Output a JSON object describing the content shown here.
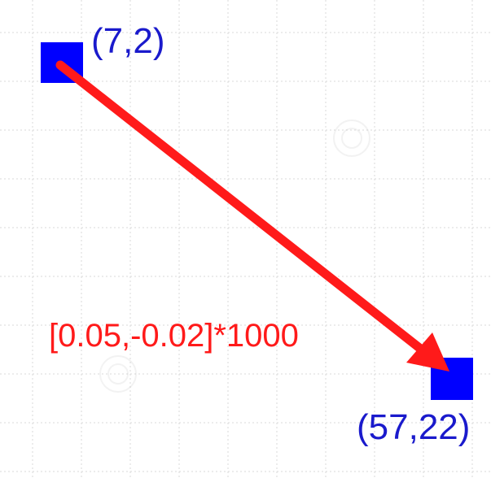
{
  "points": {
    "start": {
      "label": "(7,2)"
    },
    "end": {
      "label": "(57,22)"
    }
  },
  "vector": {
    "label": "[0.05,-0.02]*1000"
  },
  "colors": {
    "square": "#0000ff",
    "point_label": "#1a1acc",
    "arrow": "#ff1a1a",
    "vector_label": "#ff1a1a",
    "grid": "#d8d8d8",
    "background": "#ffffff"
  }
}
